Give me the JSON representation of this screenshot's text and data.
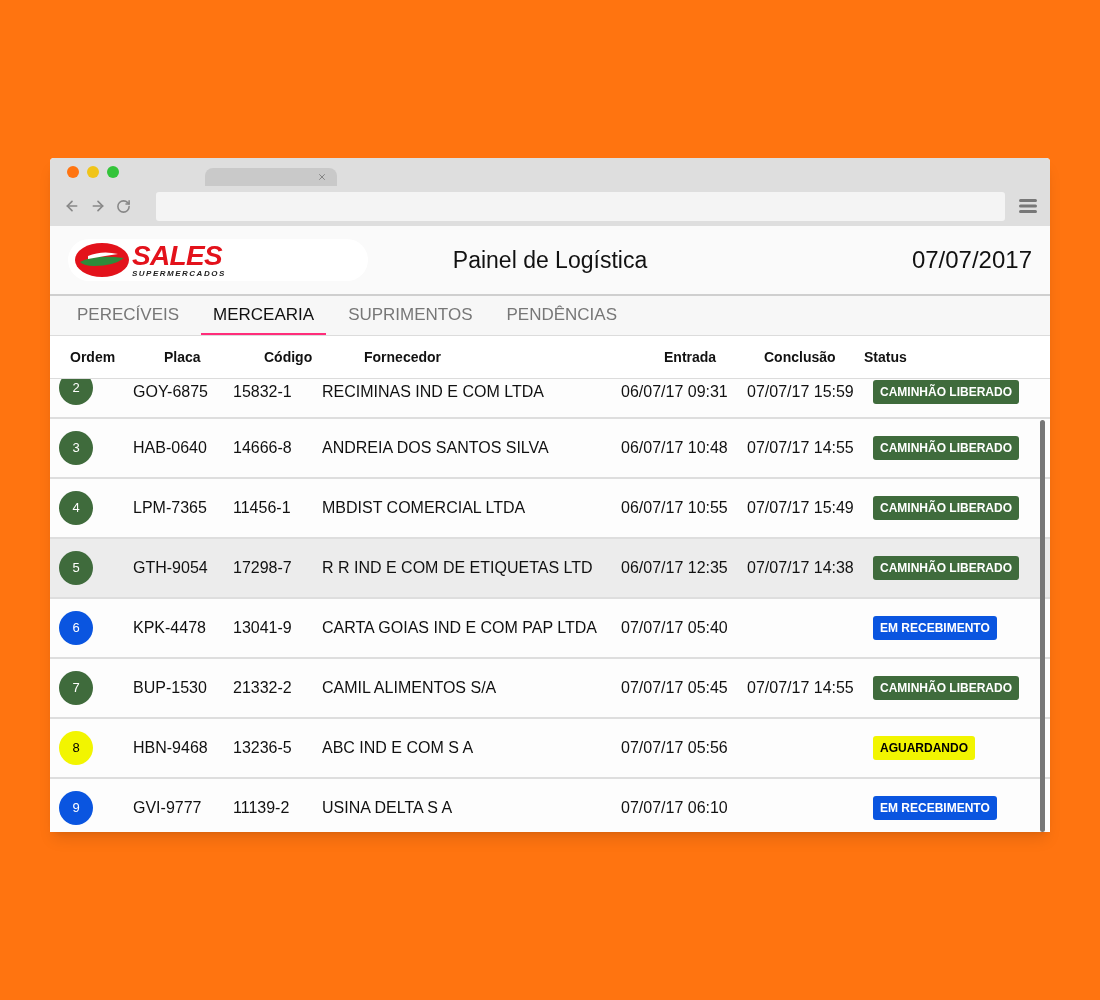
{
  "logo": {
    "name": "SALES",
    "tagline": "SUPERMERCADOS"
  },
  "header": {
    "title": "Painel de Logística",
    "date": "07/07/2017"
  },
  "tabs": [
    {
      "label": "PERECÍVEIS",
      "selected": false
    },
    {
      "label": "MERCEARIA",
      "selected": true
    },
    {
      "label": "SUPRIMENTOS",
      "selected": false
    },
    {
      "label": "PENDÊNCIAS",
      "selected": false
    }
  ],
  "table": {
    "columns": [
      "Ordem",
      "Placa",
      "Código",
      "Fornecedor",
      "Entrada",
      "Conclusão",
      "Status"
    ],
    "rows": [
      {
        "ordem": "2",
        "placa": "GOY-6875",
        "codigo": "15832-1",
        "fornecedor": "RECIMINAS IND E COM LTDA",
        "entrada": "06/07/17 09:31",
        "conclusao": "07/07/17 15:59",
        "status": "CAMINHÃO LIBERADO",
        "kind": "released",
        "selected": false
      },
      {
        "ordem": "3",
        "placa": "HAB-0640",
        "codigo": "14666-8",
        "fornecedor": "ANDREIA DOS SANTOS SILVA",
        "entrada": "06/07/17 10:48",
        "conclusao": "07/07/17 14:55",
        "status": "CAMINHÃO LIBERADO",
        "kind": "released",
        "selected": false
      },
      {
        "ordem": "4",
        "placa": "LPM-7365",
        "codigo": "11456-1",
        "fornecedor": "MBDIST COMERCIAL LTDA",
        "entrada": "06/07/17 10:55",
        "conclusao": "07/07/17 15:49",
        "status": "CAMINHÃO LIBERADO",
        "kind": "released",
        "selected": false
      },
      {
        "ordem": "5",
        "placa": "GTH-9054",
        "codigo": "17298-7",
        "fornecedor": "R R IND E COM DE ETIQUETAS LTD",
        "entrada": "06/07/17 12:35",
        "conclusao": "07/07/17 14:38",
        "status": "CAMINHÃO LIBERADO",
        "kind": "released",
        "selected": true
      },
      {
        "ordem": "6",
        "placa": "KPK-4478",
        "codigo": "13041-9",
        "fornecedor": "CARTA GOIAS IND E COM PAP LTDA",
        "entrada": "07/07/17 05:40",
        "status": "EM RECEBIMENTO",
        "kind": "receiving",
        "selected": false
      },
      {
        "ordem": "7",
        "placa": "BUP-1530",
        "codigo": "21332-2",
        "fornecedor": "CAMIL ALIMENTOS S/A",
        "entrada": "07/07/17 05:45",
        "conclusao": "07/07/17 14:55",
        "status": "CAMINHÃO LIBERADO",
        "kind": "released",
        "selected": false
      },
      {
        "ordem": "8",
        "placa": "HBN-9468",
        "codigo": "13236-5",
        "fornecedor": "ABC IND E COM S A",
        "entrada": "07/07/17 05:56",
        "status": "AGUARDANDO",
        "kind": "waiting",
        "selected": false
      },
      {
        "ordem": "9",
        "placa": "GVI-9777",
        "codigo": "11139-2",
        "fornecedor": "USINA DELTA S A",
        "entrada": "07/07/17 06:10",
        "status": "EM RECEBIMENTO",
        "kind": "receiving",
        "selected": false
      }
    ]
  }
}
